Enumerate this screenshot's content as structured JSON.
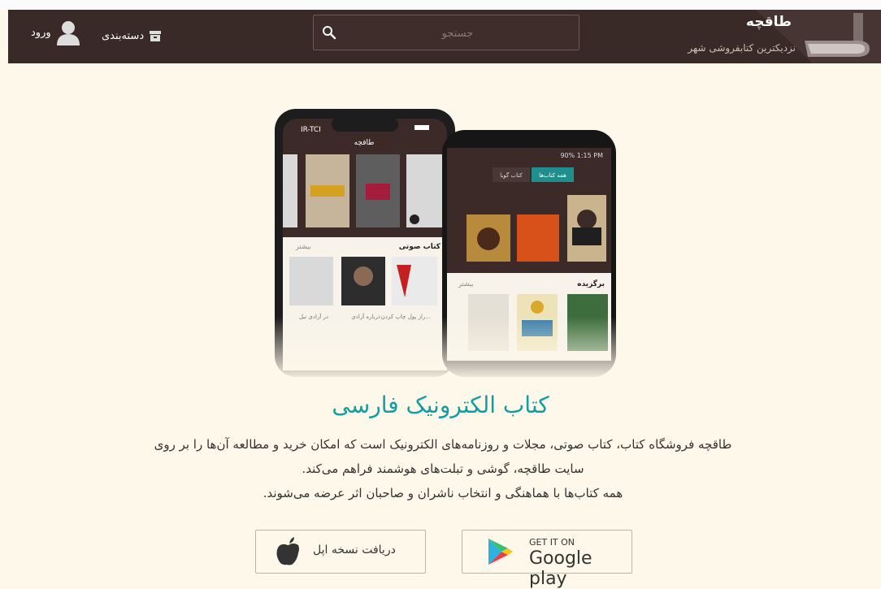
{
  "brand": {
    "name": "طاقچه",
    "tagline": "نزدیکترین کتابفروشی شهر"
  },
  "search": {
    "placeholder": "جستجو"
  },
  "nav": {
    "categories_label": "دسته‌بندی",
    "login_label": "ورود"
  },
  "hero": {
    "phone1_status": "IR-TCI",
    "phone1_title": "طاقچه",
    "phone1_section": "کتاب صوتی",
    "phone1_more": "بیشتر",
    "phone1_book_titles": [
      "راز پول چاپ کردن...",
      "درباره آزادی",
      "در آزادی نیل"
    ],
    "phone2_status": "90% 1:15 PM",
    "phone2_tab_active": "همه کتاب‌ها",
    "phone2_tab_inactive": "کتاب گویا",
    "phone2_section": "برگزیده",
    "phone2_more": "بیشتر"
  },
  "main": {
    "title": "کتاب الکترونیک فارسی",
    "desc_line1": "طاقچه فروشگاه کتاب، کتاب صوتی، مجلات و روزنامه‌های الکترونیک است که امکان خرید و مطالعه آن‌ها را بر روی",
    "desc_line2": "سایت طاقچه، گوشی و تبلت‌های هوشمند فراهم می‌کند.",
    "desc_line3": "همه کتاب‌ها با هماهنگی و انتخاب ناشران و صاحبان اثر عرضه می‌شوند."
  },
  "buttons": {
    "googleplay_small": "GET IT ON",
    "googleplay_big": "Google play",
    "apple_label": "دریافت نسخه اپل"
  },
  "colors": {
    "header_bg": "#3a2a27",
    "page_bg": "#fdf8e9",
    "accent": "#0f9ea3",
    "tab_active": "#1f8f8d"
  }
}
